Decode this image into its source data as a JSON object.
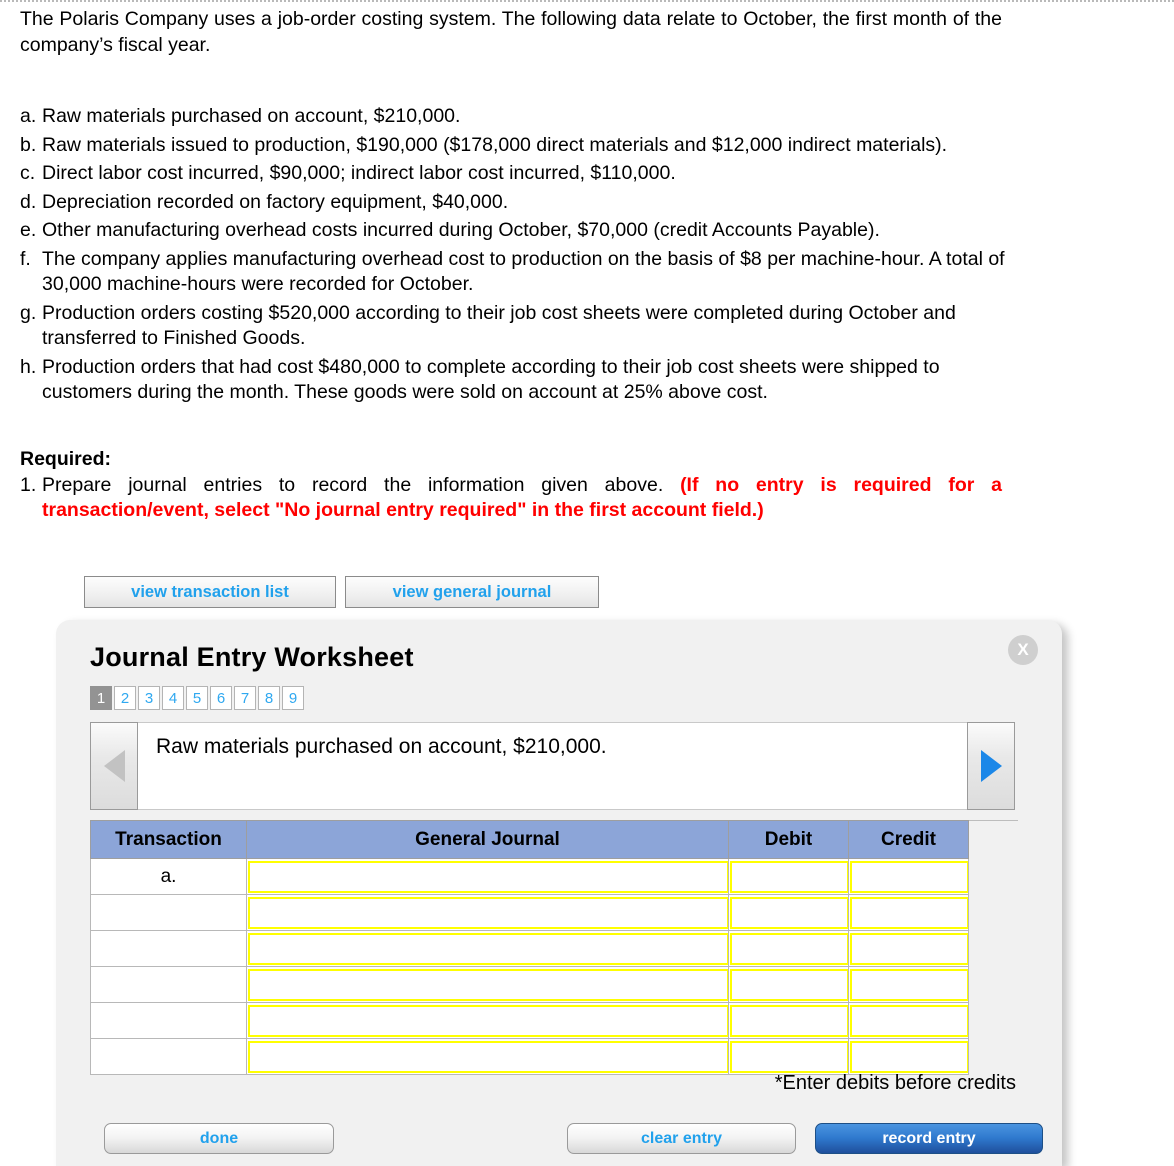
{
  "problem": {
    "intro": "The Polaris Company uses a job-order costing system. The following data relate to October, the first month of the company’s fiscal year.",
    "items": [
      {
        "marker": "a.",
        "text": "Raw materials purchased on account, $210,000."
      },
      {
        "marker": "b.",
        "text": "Raw materials issued to production, $190,000 ($178,000 direct materials and $12,000 indirect materials)."
      },
      {
        "marker": "c.",
        "text": "Direct labor cost incurred, $90,000; indirect labor cost incurred, $110,000."
      },
      {
        "marker": "d.",
        "text": "Depreciation recorded on factory equipment, $40,000."
      },
      {
        "marker": "e.",
        "text": "Other manufacturing overhead costs incurred during October, $70,000 (credit Accounts Payable)."
      },
      {
        "marker": "f.",
        "text": "The company applies manufacturing overhead cost to production on the basis of $8 per machine-hour. A total of 30,000 machine-hours were recorded for October."
      },
      {
        "marker": "g.",
        "text": "Production orders costing $520,000 according to their job cost sheets were completed during October and transferred to Finished Goods."
      },
      {
        "marker": "h.",
        "text": "Production orders that had cost $480,000 to complete according to their job cost sheets were shipped to customers during the month. These goods were sold on account at 25% above cost."
      }
    ],
    "required_label": "Required:",
    "required_number": "1.",
    "required_text": "Prepare journal entries to record the information given above. ",
    "required_red": "(If no entry is required for a transaction/event, select \"No journal entry required\" in the first account field.)"
  },
  "view_buttons": {
    "transaction_list": "view transaction list",
    "general_journal": "view general journal"
  },
  "worksheet": {
    "title": "Journal Entry Worksheet",
    "close_label": "X",
    "tabs": [
      "1",
      "2",
      "3",
      "4",
      "5",
      "6",
      "7",
      "8",
      "9"
    ],
    "active_tab": "1",
    "prev_arrow": "prev-arrow-icon",
    "next_arrow": "next-arrow-icon",
    "prompt": "Raw materials purchased on account, $210,000.",
    "table": {
      "headers": [
        "Transaction",
        "General Journal",
        "Debit",
        "Credit"
      ],
      "rows": [
        {
          "transaction": "a.",
          "general_journal": "",
          "debit": "",
          "credit": ""
        },
        {
          "transaction": "",
          "general_journal": "",
          "debit": "",
          "credit": ""
        },
        {
          "transaction": "",
          "general_journal": "",
          "debit": "",
          "credit": ""
        },
        {
          "transaction": "",
          "general_journal": "",
          "debit": "",
          "credit": ""
        },
        {
          "transaction": "",
          "general_journal": "",
          "debit": "",
          "credit": ""
        },
        {
          "transaction": "",
          "general_journal": "",
          "debit": "",
          "credit": ""
        }
      ]
    },
    "footnote": "*Enter debits before credits",
    "buttons": {
      "done": "done",
      "clear_entry": "clear entry",
      "record_entry": "record entry"
    }
  },
  "colors": {
    "table_header_blue": "#8ca5d8",
    "link_blue": "#21a1ec",
    "required_red": "#ff0000",
    "cell_border_yellow": "#ffff00",
    "record_button_blue": "#2f79ce",
    "active_tab_gray": "#939393",
    "panel_background": "#f1f1f1"
  }
}
